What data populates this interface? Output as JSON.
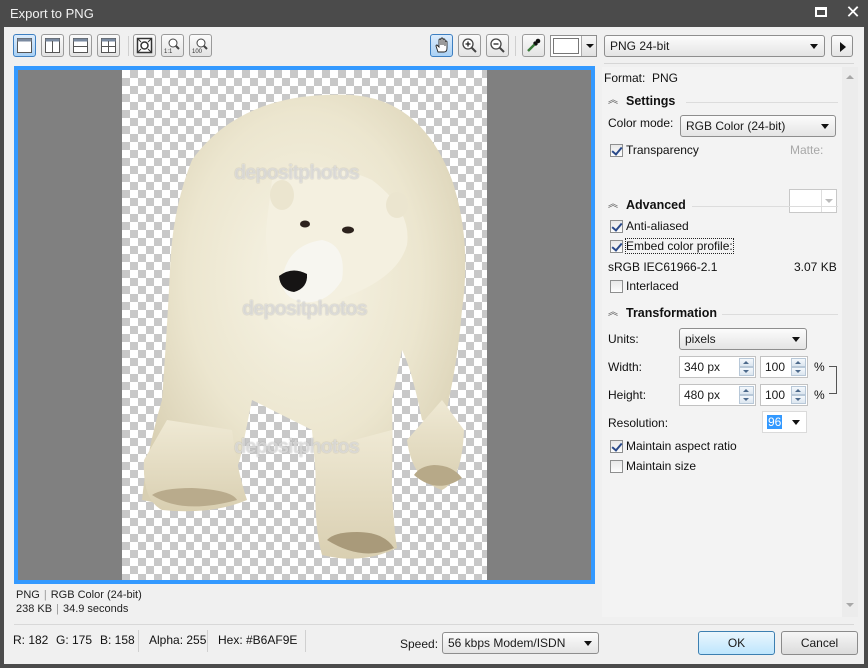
{
  "window": {
    "title": "Export to PNG",
    "maximize_icon": "maximize-icon",
    "close_icon": "close-icon"
  },
  "toolbar": {
    "view_buttons": [
      {
        "name": "single-view",
        "icon": "single-pane-icon",
        "active": true
      },
      {
        "name": "split-vertical-view",
        "icon": "split-vertical-icon",
        "active": false
      },
      {
        "name": "split-horizontal-view",
        "icon": "split-horizontal-icon",
        "active": false
      },
      {
        "name": "quad-view",
        "icon": "quad-pane-icon",
        "active": false
      }
    ],
    "zoom_buttons": [
      {
        "name": "zoom-to-fit",
        "icon": "zoom-fit-icon"
      },
      {
        "name": "zoom-1-1",
        "icon": "zoom-1to1-icon",
        "label": "1:1"
      },
      {
        "name": "zoom-100",
        "icon": "zoom-100-icon",
        "label": "100"
      }
    ],
    "tools": [
      {
        "name": "pan",
        "icon": "hand-icon",
        "active": true
      },
      {
        "name": "zoom-in",
        "icon": "zoom-in-icon"
      },
      {
        "name": "zoom-out",
        "icon": "zoom-out-icon"
      },
      {
        "name": "eyedropper",
        "icon": "eyedropper-icon"
      }
    ],
    "color_swatch": "#FFFFFF",
    "format_preset": "PNG 24-bit",
    "next_icon": "play-right-icon"
  },
  "preview": {
    "watermark_text": "depositphotos",
    "info_line1": [
      "PNG",
      "RGB Color (24-bit)"
    ],
    "info_line2": [
      "238 KB",
      "34.9 seconds"
    ]
  },
  "status": {
    "r": "R: 182",
    "g": "G: 175",
    "b": "B: 158",
    "alpha": "Alpha: 255",
    "hex": "Hex: #B6AF9E",
    "speed_label": "Speed:",
    "speed_value": "56 kbps Modem/ISDN"
  },
  "buttons": {
    "ok": "OK",
    "cancel": "Cancel"
  },
  "panel": {
    "format_label": "Format:",
    "format_value": "PNG",
    "settings": {
      "heading": "Settings",
      "color_mode_label": "Color mode:",
      "color_mode_value": "RGB Color (24-bit)",
      "transparency_label": "Transparency",
      "transparency_checked": true,
      "matte_label": "Matte:"
    },
    "advanced": {
      "heading": "Advanced",
      "anti_aliased_label": "Anti-aliased",
      "anti_aliased_checked": true,
      "embed_profile_label": "Embed color profile:",
      "embed_profile_checked": true,
      "profile_name": "sRGB IEC61966-2.1",
      "profile_size": "3.07 KB",
      "interlaced_label": "Interlaced",
      "interlaced_checked": false
    },
    "transformation": {
      "heading": "Transformation",
      "units_label": "Units:",
      "units_value": "pixels",
      "width_label": "Width:",
      "width_value": "340 px",
      "width_pct": "100",
      "height_label": "Height:",
      "height_value": "480 px",
      "height_pct": "100",
      "pct_symbol": "%",
      "resolution_label": "Resolution:",
      "resolution_value": "96",
      "maintain_aspect_label": "Maintain aspect ratio",
      "maintain_aspect_checked": true,
      "maintain_size_label": "Maintain size",
      "maintain_size_checked": false
    }
  }
}
